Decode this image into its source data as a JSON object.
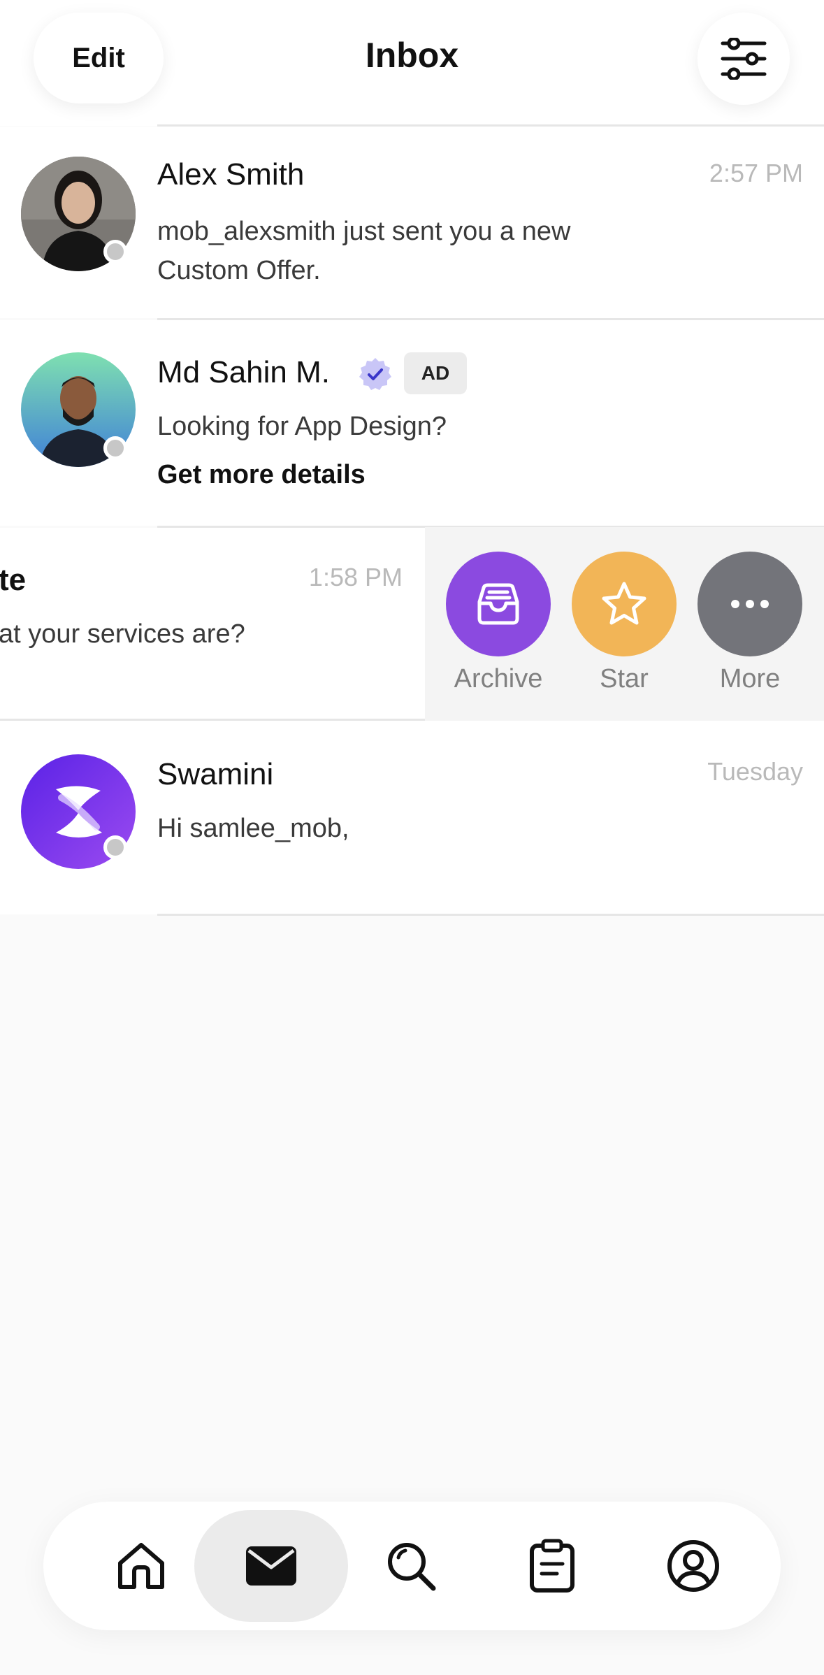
{
  "header": {
    "edit_label": "Edit",
    "title": "Inbox",
    "filter_icon": "sliders-icon"
  },
  "conversations": [
    {
      "name": "Alex Smith",
      "time": "2:57 PM",
      "message_line1": "mob_alexsmith just sent you a new",
      "message_line2": "Custom Offer.",
      "avatar": "woman-photo-avatar",
      "online": false
    },
    {
      "name": "Md Sahin M.",
      "verified": true,
      "badge": "AD",
      "message": "Looking for App Design?",
      "cta": "Get more details",
      "avatar": "man-photo-avatar"
    },
    {
      "name": "te",
      "time": "1:58 PM",
      "message": "at your services are?",
      "swiped": true
    },
    {
      "name": "Swamini",
      "time": "Tuesday",
      "message": "Hi samlee_mob,",
      "avatar": "swamini-logo-avatar"
    }
  ],
  "swipe_actions": [
    {
      "label": "Archive",
      "icon": "archive-tray-icon",
      "color": "#8b4ae0"
    },
    {
      "label": "Star",
      "icon": "star-icon",
      "color": "#f2b557"
    },
    {
      "label": "More",
      "icon": "more-dots-icon",
      "color": "#73747a"
    }
  ],
  "tabbar": {
    "tabs": [
      {
        "icon": "home-icon",
        "active": false
      },
      {
        "icon": "mail-icon",
        "active": true
      },
      {
        "icon": "search-icon",
        "active": false
      },
      {
        "icon": "clipboard-icon",
        "active": false
      },
      {
        "icon": "profile-icon",
        "active": false
      }
    ]
  },
  "colors": {
    "accent_purple": "#8b4ae0",
    "star_orange": "#f2b557",
    "more_gray": "#73747a",
    "verified_badge": "#c9c6f7"
  }
}
